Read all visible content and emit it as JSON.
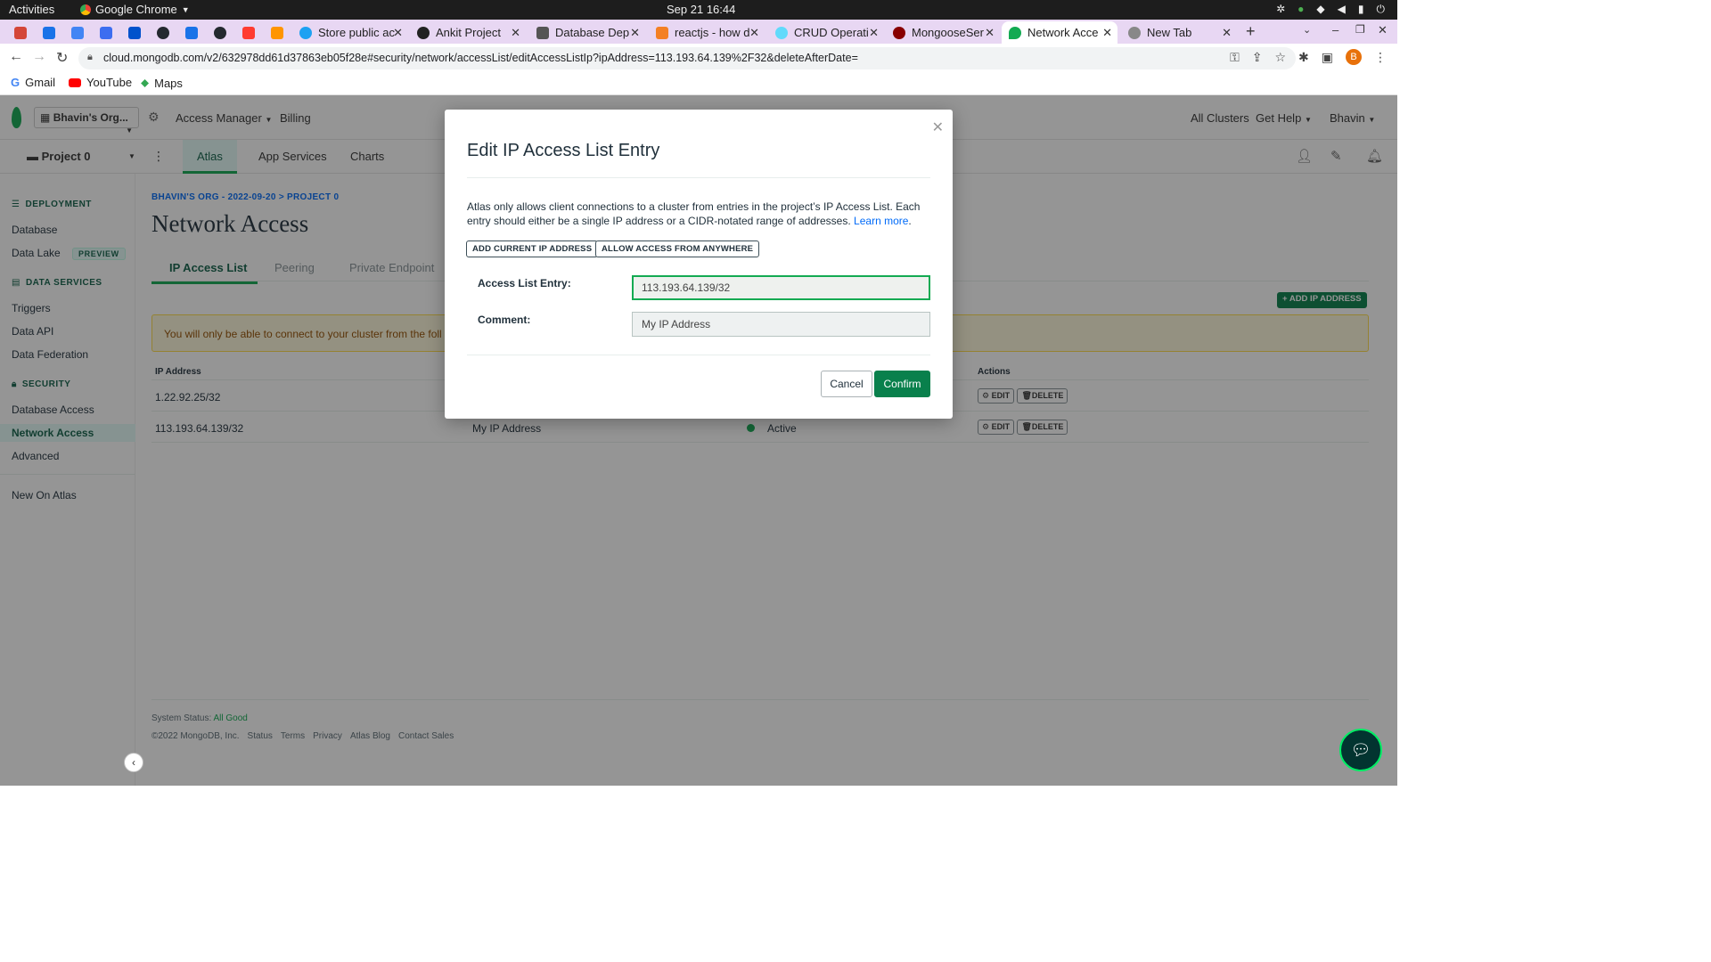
{
  "os": {
    "activities": "Activities",
    "app_name": "Google Chrome",
    "clock": "Sep 21  16:44"
  },
  "tabs": [
    {
      "title": "",
      "color": "#d44638"
    },
    {
      "title": "",
      "color": "#1a73e8"
    },
    {
      "title": "",
      "color": "#4285f4"
    },
    {
      "title": "",
      "color": "#3c6df0"
    },
    {
      "title": "",
      "color": "#0052cc"
    },
    {
      "title": "",
      "color": "#24292f"
    },
    {
      "title": "",
      "color": "#1a73e8"
    },
    {
      "title": "",
      "color": "#24292f"
    },
    {
      "title": "",
      "color": "#ff3b30"
    },
    {
      "title": "",
      "color": "#ff9500"
    },
    {
      "title": "Store public ac",
      "color": "#1da1f2"
    },
    {
      "title": "Ankit Project",
      "color": "#222"
    },
    {
      "title": "Database Dep",
      "color": "#555"
    },
    {
      "title": "reactjs - how d",
      "color": "#f48024"
    },
    {
      "title": "CRUD Operati",
      "color": "#61dafb"
    },
    {
      "title": "MongooseSer",
      "color": "#880000"
    },
    {
      "title": "Network Acce",
      "color": "#13aa52"
    },
    {
      "title": "New Tab",
      "color": "#888"
    }
  ],
  "url": "cloud.mongodb.com/v2/632978dd61d37863eb05f28e#security/network/accessList/editAccessListIp?ipAddress=113.193.64.139%2F32&deleteAfterDate=",
  "profile_initial": "B",
  "bookmarks": [
    "Gmail",
    "YouTube",
    "Maps"
  ],
  "topnav": {
    "org": "Bhavin's Org...",
    "access_manager": "Access Manager",
    "billing": "Billing",
    "all_clusters": "All Clusters",
    "get_help": "Get Help",
    "user": "Bhavin"
  },
  "subnav": {
    "project": "Project 0",
    "atlas": "Atlas",
    "app_services": "App Services",
    "charts": "Charts"
  },
  "sidebar": {
    "deployment": "DEPLOYMENT",
    "database": "Database",
    "data_lake": "Data Lake",
    "preview": "PREVIEW",
    "data_services": "DATA SERVICES",
    "triggers": "Triggers",
    "data_api": "Data API",
    "data_federation": "Data Federation",
    "security": "SECURITY",
    "database_access": "Database Access",
    "network_access": "Network Access",
    "advanced": "Advanced",
    "new_on_atlas": "New On Atlas"
  },
  "main": {
    "breadcrumb": "BHAVIN'S ORG - 2022-09-20 > PROJECT 0",
    "title": "Network Access",
    "tabs": [
      "IP Access List",
      "Peering",
      "Private Endpoint"
    ],
    "add_ip": "+ ADD IP ADDRESS",
    "warning": "You will only be able to connect to your cluster from the foll",
    "columns": {
      "ip": "IP Address",
      "actions": "Actions"
    },
    "rows": [
      {
        "ip": "1.22.92.25/32",
        "comment": "",
        "status": ""
      },
      {
        "ip": "113.193.64.139/32",
        "comment": "My IP Address",
        "status": "Active"
      }
    ],
    "edit": "EDIT",
    "delete": "DELETE",
    "footer_status_label": "System Status:",
    "footer_status": "All Good",
    "footer_links": [
      "©2022 MongoDB, Inc.",
      "Status",
      "Terms",
      "Privacy",
      "Atlas Blog",
      "Contact Sales"
    ]
  },
  "modal": {
    "title": "Edit IP Access List Entry",
    "desc": "Atlas only allows client connections to a cluster from entries in the project’s IP Access List. Each entry should either be a single IP address or a CIDR-notated range of addresses.",
    "learn_more": "Learn more",
    "add_current": "ADD CURRENT IP ADDRESS",
    "allow_anywhere": "ALLOW ACCESS FROM ANYWHERE",
    "entry_label": "Access List Entry:",
    "entry_value": "113.193.64.139/32",
    "comment_label": "Comment:",
    "comment_value": "My IP Address",
    "cancel": "Cancel",
    "confirm": "Confirm"
  },
  "colors": {
    "brand_green": "#09804c",
    "active_dot": "#13aa52",
    "tab_strip": "#e8d7f3",
    "warning_bg": "#fef7db"
  }
}
